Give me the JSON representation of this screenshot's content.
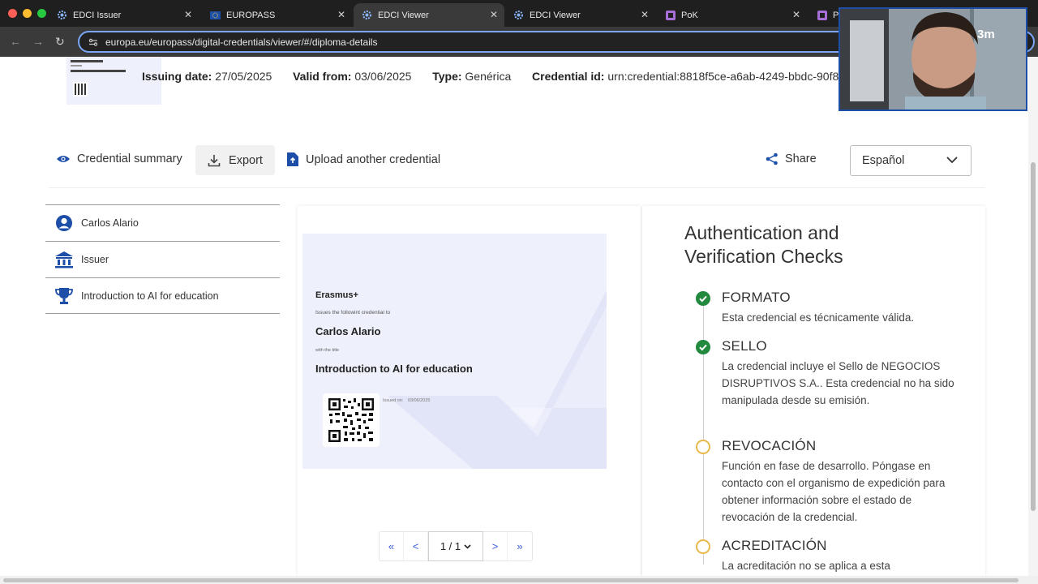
{
  "browser": {
    "tabs": [
      {
        "title": "EDCI Issuer",
        "active": false
      },
      {
        "title": "EUROPASS",
        "active": false
      },
      {
        "title": "EDCI Viewer",
        "active": true
      },
      {
        "title": "EDCI Viewer",
        "active": false
      },
      {
        "title": "PoK",
        "active": false
      },
      {
        "title": "Po",
        "active": false
      }
    ],
    "url": "europa.eu/europass/digital-credentials/viewer/#/diploma-details"
  },
  "credential_meta": {
    "issuing_label": "Issuing date:",
    "issuing_value": "27/05/2025",
    "valid_label": "Valid from:",
    "valid_value": "03/06/2025",
    "type_label": "Type:",
    "type_value": "Genérica",
    "id_label": "Credential id:",
    "id_value": "urn:credential:8818f5ce-a6ab-4249-bbdc-90f86"
  },
  "toolbar": {
    "summary_label": "Credential summary",
    "export_label": "Export",
    "upload_label": "Upload another credential",
    "share_label": "Share",
    "language_value": "Español"
  },
  "sidebar": {
    "items": [
      {
        "label": "Carlos Alario",
        "icon": "person-icon"
      },
      {
        "label": "Issuer",
        "icon": "institution-icon"
      },
      {
        "label": "Introduction to AI for education",
        "icon": "trophy-icon"
      }
    ]
  },
  "diploma": {
    "org": "Erasmus+",
    "issues_text": "Issues the followint credential to",
    "recipient": "Carlos Alario",
    "with_title": "with the title",
    "course": "Introduction to AI for education",
    "issued_on_label": "Issued on:",
    "issued_on_value": "03/06/2025"
  },
  "pager": {
    "first": "«",
    "prev": "<",
    "current": "1 / 1",
    "next": ">",
    "last": "»"
  },
  "checks": {
    "title": "Authentication and Verification Checks",
    "items": [
      {
        "name": "FORMATO",
        "status": "ok",
        "text": "Esta credencial es técnicamente válida."
      },
      {
        "name": "SELLO",
        "status": "ok",
        "text": "La credencial incluye el Sello de NEGOCIOS DISRUPTIVOS S.A.. Esta credencial no ha sido manipulada desde su emisión."
      },
      {
        "name": "REVOCACIÓN",
        "status": "pending",
        "text": "Función en fase de desarrollo. Póngase en contacto con el organismo de expedición para obtener información sobre el estado de revocación de la credencial."
      },
      {
        "name": "ACREDITACIÓN",
        "status": "pending",
        "text": "La acreditación no se aplica a esta"
      }
    ]
  },
  "overlay": {
    "timer": "3m"
  },
  "colors": {
    "ok": "#218a3f",
    "pending": "#e8b84a",
    "link_blue": "#3b5bdb",
    "brand_blue": "#1d4fa8"
  }
}
